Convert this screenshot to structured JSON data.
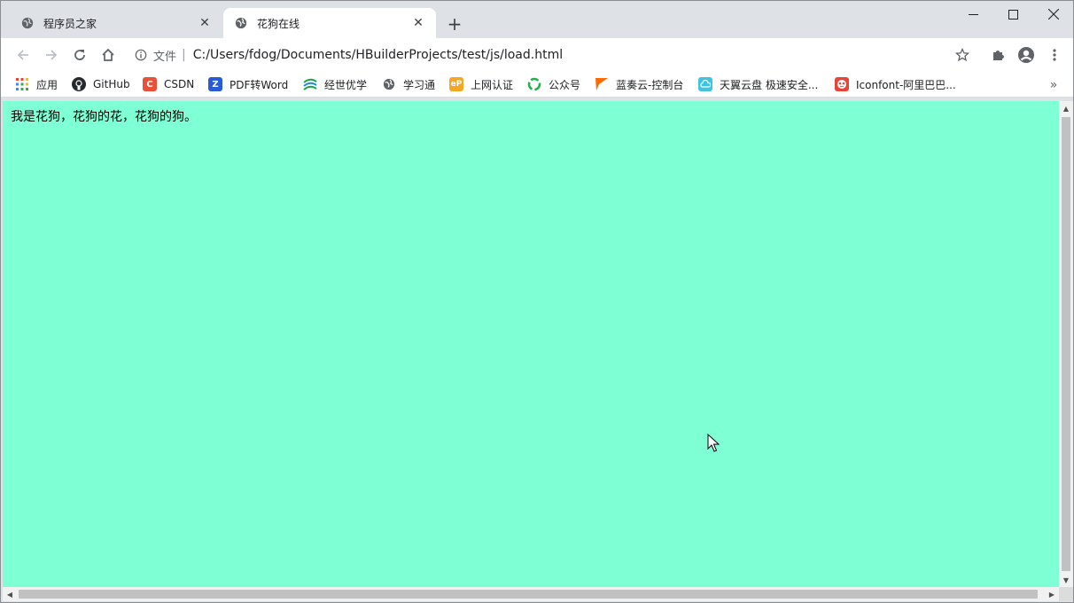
{
  "window": {
    "controls": {
      "minimize": "—",
      "maximize": "☐",
      "close": "✕"
    }
  },
  "tabs": [
    {
      "label": "程序员之家",
      "active": false,
      "icon": "globe-icon"
    },
    {
      "label": "花狗在线",
      "active": true,
      "icon": "globe-icon"
    }
  ],
  "toolbar": {
    "scheme_label": "文件",
    "url": "C:/Users/fdog/Documents/HBuilderProjects/test/js/load.html"
  },
  "bookmarks": [
    {
      "label": "应用",
      "icon": "apps-grid-icon"
    },
    {
      "label": "GitHub",
      "icon": "github-icon",
      "color": "#24292e"
    },
    {
      "label": "CSDN",
      "icon": "csdn-icon",
      "color": "#e8503a",
      "glyph": "C"
    },
    {
      "label": "PDF转Word",
      "icon": "pdf-to-word-icon",
      "color": "#2a5bd7",
      "glyph": "Z"
    },
    {
      "label": "经世优学",
      "icon": "jingshi-icon",
      "color": "#1aa34a"
    },
    {
      "label": "学习通",
      "icon": "globe-icon"
    },
    {
      "label": "上网认证",
      "icon": "eportal-icon",
      "color": "#f5a623",
      "glyph": "eP"
    },
    {
      "label": "公众号",
      "icon": "wechat-mp-icon",
      "color": "#23b14d"
    },
    {
      "label": "蓝奏云-控制台",
      "icon": "lanzou-icon",
      "color": "#ff6a00"
    },
    {
      "label": "天翼云盘 极速安全...",
      "icon": "tianyi-cloud-icon",
      "color": "#3fc3e0"
    },
    {
      "label": "Iconfont-阿里巴巴...",
      "icon": "iconfont-icon",
      "color": "#e8443a"
    }
  ],
  "page": {
    "text": "我是花狗，花狗的花，花狗的狗。",
    "background": "#7fffd4"
  }
}
